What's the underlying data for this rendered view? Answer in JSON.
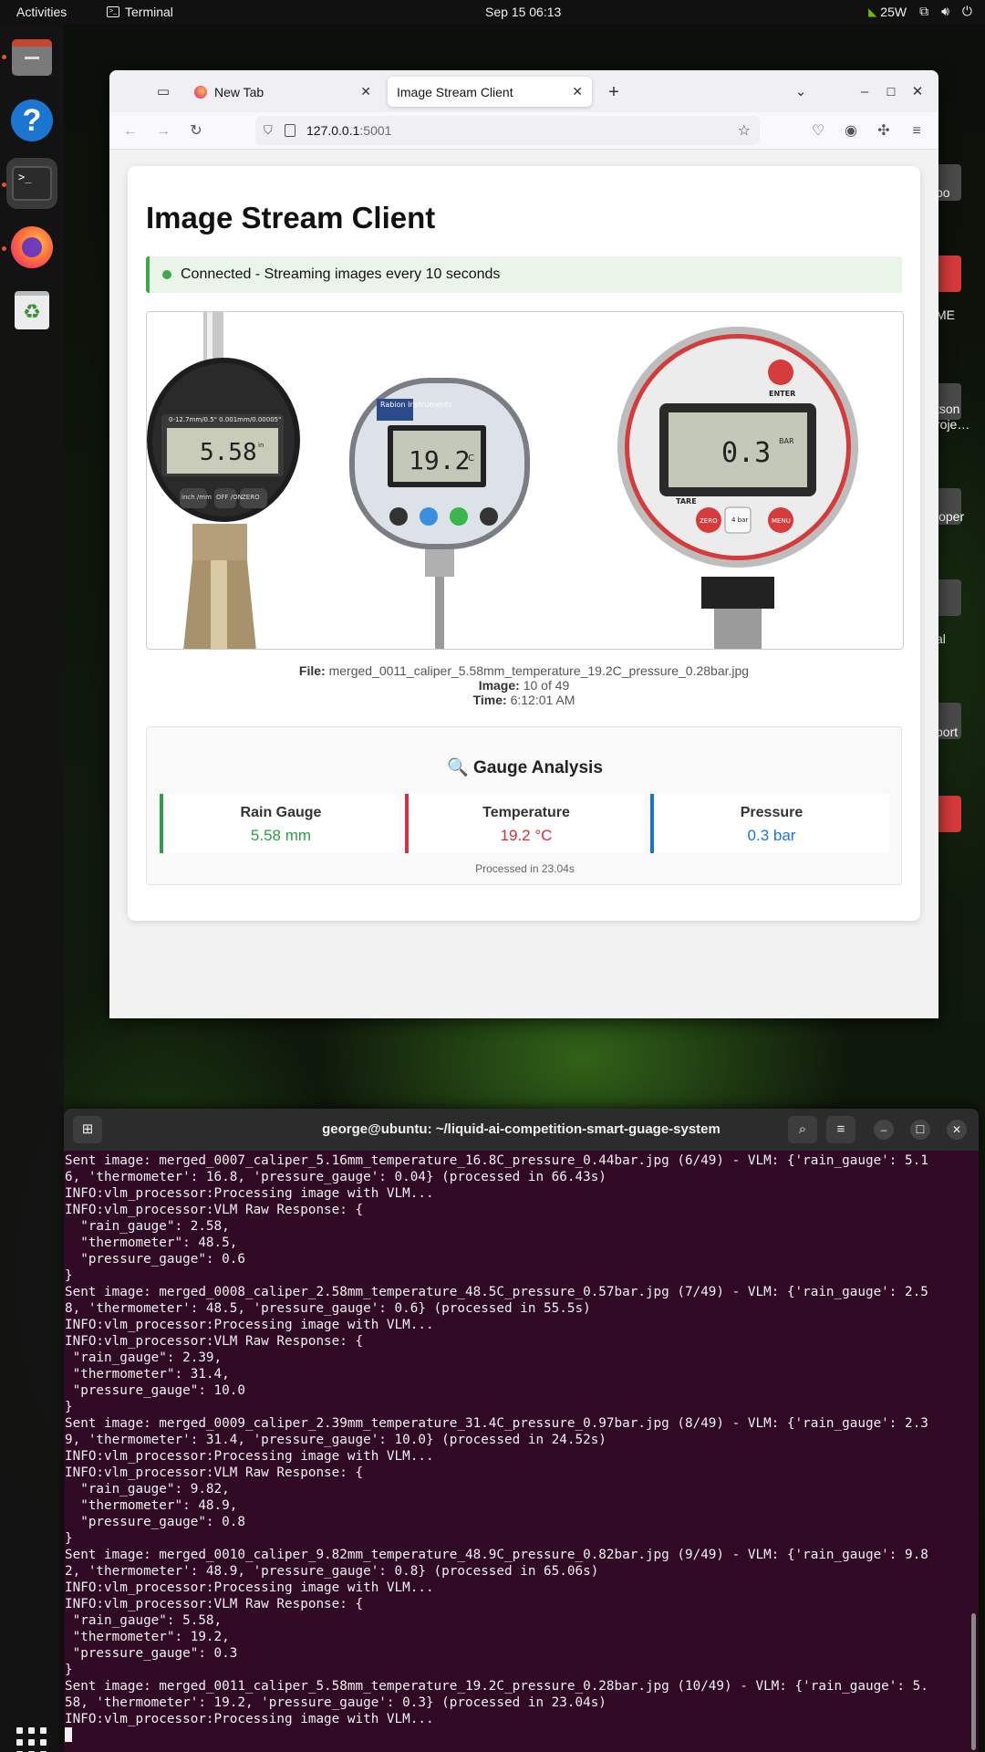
{
  "topbar": {
    "activities": "Activities",
    "app_name": "Terminal",
    "clock": "Sep 15  06:13",
    "power_draw": "25W"
  },
  "dock": {
    "items": [
      "Files",
      "Help",
      "Terminal",
      "Firefox",
      "Trash"
    ]
  },
  "desktop_labels": [
    "bo",
    "ME",
    "tson\nroje…",
    "loper",
    "al",
    "port"
  ],
  "browser": {
    "tabs": [
      {
        "label": "New Tab"
      },
      {
        "label": "Image Stream Client"
      }
    ],
    "url_host": "127.0.0.1",
    "url_port": ":5001"
  },
  "page": {
    "title": "Image Stream Client",
    "status": "Connected - Streaming images every 10 seconds",
    "gauges_image": {
      "caliper_reading": "5.58",
      "caliper_unit": "in",
      "caliper_scale": "0-12.7mm/0.5\"   0.001mm/0.00005\"",
      "caliper_buttons": [
        "inch\n/mm",
        "OFF\n/ON",
        "ZERO"
      ],
      "thermo_brand": "Rabion\nInstruments",
      "thermo_reading": "19.2",
      "thermo_unit": "C",
      "pressure_reading": "0.3",
      "pressure_unit": "BAR",
      "pressure_enter": "ENTER",
      "pressure_tare": "TARE",
      "pressure_zero": "ZERO",
      "pressure_menu": "MENU",
      "pressure_center": "4\nbar"
    },
    "file_label": "File:",
    "file_name": "merged_0011_caliper_5.58mm_temperature_19.2C_pressure_0.28bar.jpg",
    "image_label": "Image:",
    "image_index": "10 of 49",
    "time_label": "Time:",
    "time_value": "6:12:01 AM",
    "analysis": {
      "heading_icon": "🔍",
      "heading": "Gauge Analysis",
      "metrics": [
        {
          "label": "Rain Gauge",
          "value": "5.58 mm",
          "color": "#2e9e44"
        },
        {
          "label": "Temperature",
          "value": "19.2 °C",
          "color": "#d4303f"
        },
        {
          "label": "Pressure",
          "value": "0.3 bar",
          "color": "#1a73d9"
        }
      ],
      "processed": "Processed in 23.04s"
    }
  },
  "terminal": {
    "title": "george@ubuntu: ~/liquid-ai-competition-smart-guage-system",
    "lines": [
      "Sent image: merged_0007_caliper_5.16mm_temperature_16.8C_pressure_0.44bar.jpg (6/49) - VLM: {'rain_gauge': 5.1",
      "6, 'thermometer': 16.8, 'pressure_gauge': 0.04} (processed in 66.43s)",
      "INFO:vlm_processor:Processing image with VLM...",
      "INFO:vlm_processor:VLM Raw Response: {",
      "  \"rain_gauge\": 2.58,",
      "  \"thermometer\": 48.5,",
      "  \"pressure_gauge\": 0.6",
      "}",
      "Sent image: merged_0008_caliper_2.58mm_temperature_48.5C_pressure_0.57bar.jpg (7/49) - VLM: {'rain_gauge': 2.5",
      "8, 'thermometer': 48.5, 'pressure_gauge': 0.6} (processed in 55.5s)",
      "INFO:vlm_processor:Processing image with VLM...",
      "INFO:vlm_processor:VLM Raw Response: {",
      " \"rain_gauge\": 2.39,",
      " \"thermometer\": 31.4,",
      " \"pressure_gauge\": 10.0",
      "}",
      "Sent image: merged_0009_caliper_2.39mm_temperature_31.4C_pressure_0.97bar.jpg (8/49) - VLM: {'rain_gauge': 2.3",
      "9, 'thermometer': 31.4, 'pressure_gauge': 10.0} (processed in 24.52s)",
      "INFO:vlm_processor:Processing image with VLM...",
      "INFO:vlm_processor:VLM Raw Response: {",
      "  \"rain_gauge\": 9.82,",
      "  \"thermometer\": 48.9,",
      "  \"pressure_gauge\": 0.8",
      "}",
      "Sent image: merged_0010_caliper_9.82mm_temperature_48.9C_pressure_0.82bar.jpg (9/49) - VLM: {'rain_gauge': 9.8",
      "2, 'thermometer': 48.9, 'pressure_gauge': 0.8} (processed in 65.06s)",
      "INFO:vlm_processor:Processing image with VLM...",
      "INFO:vlm_processor:VLM Raw Response: {",
      " \"rain_gauge\": 5.58,",
      " \"thermometer\": 19.2,",
      " \"pressure_gauge\": 0.3",
      "}",
      "Sent image: merged_0011_caliper_5.58mm_temperature_19.2C_pressure_0.28bar.jpg (10/49) - VLM: {'rain_gauge': 5.",
      "58, 'thermometer': 19.2, 'pressure_gauge': 0.3} (processed in 23.04s)",
      "INFO:vlm_processor:Processing image with VLM..."
    ]
  }
}
